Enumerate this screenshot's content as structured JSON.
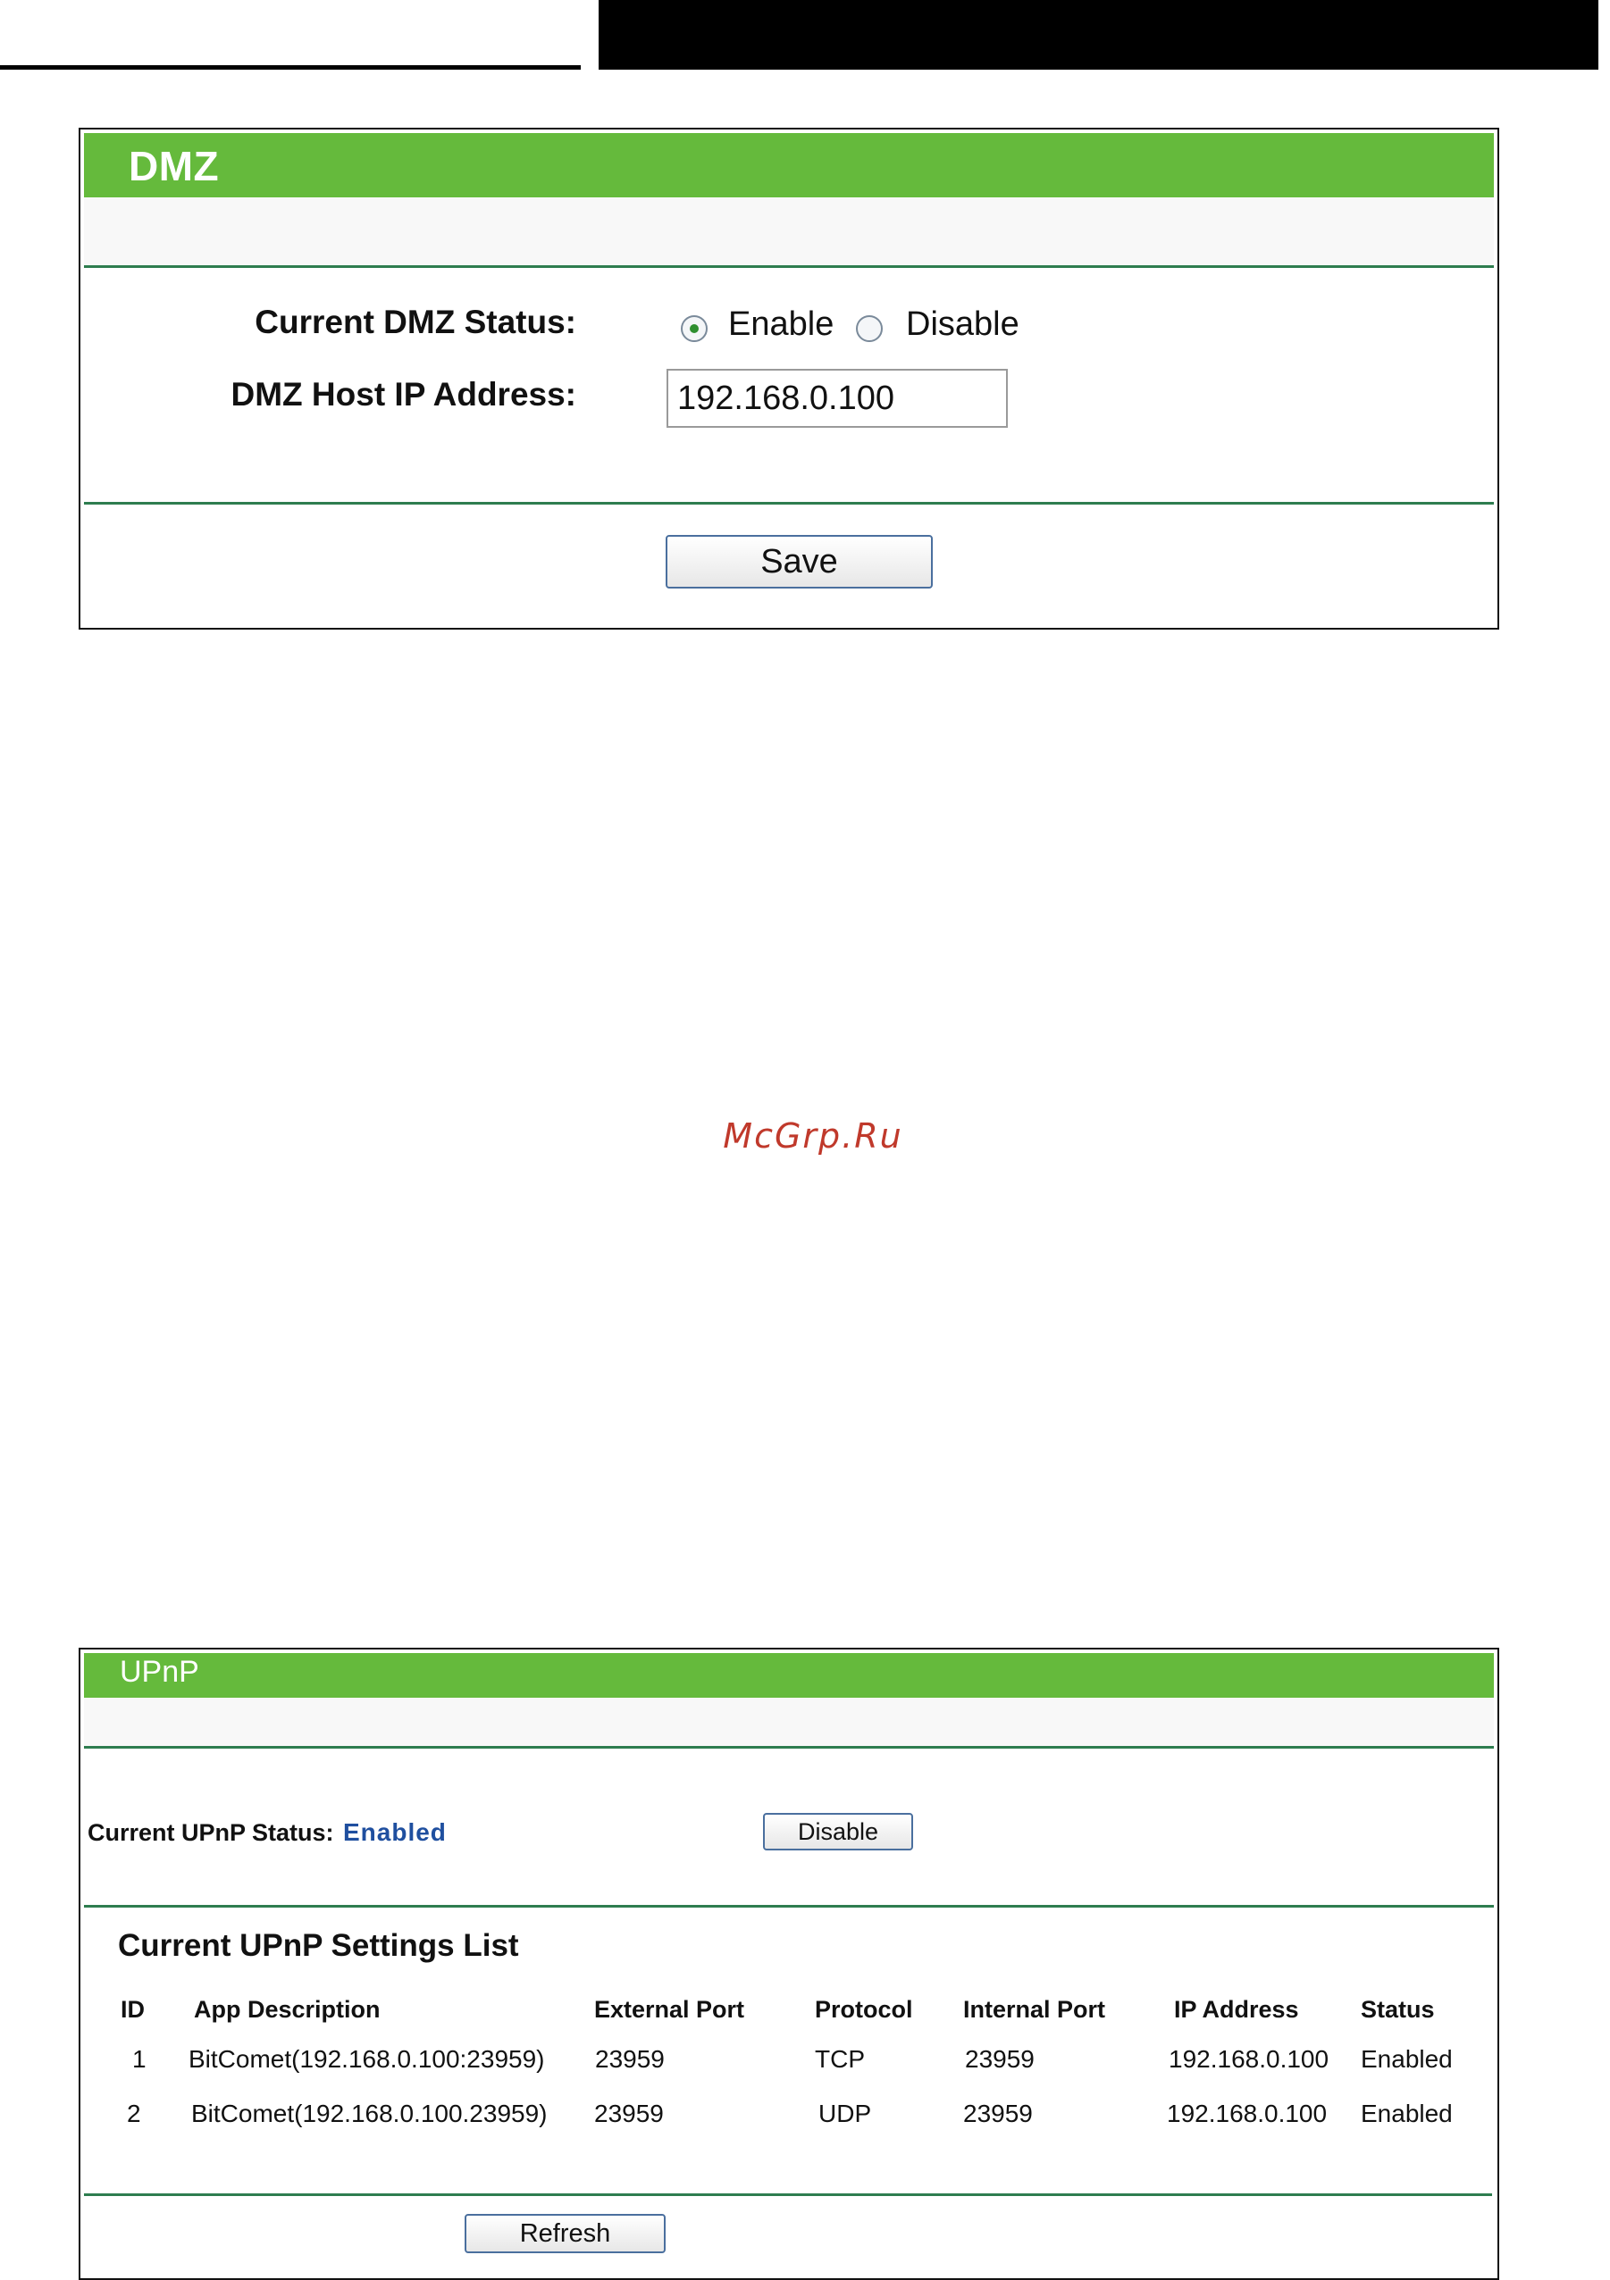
{
  "dmz": {
    "title": "DMZ",
    "status_label": "Current DMZ Status:",
    "enable_label": "Enable",
    "disable_label": "Disable",
    "selected": "Enable",
    "host_ip_label": "DMZ Host IP Address:",
    "host_ip_value": "192.168.0.100",
    "save_label": "Save"
  },
  "watermark": "McGrp.Ru",
  "upnp": {
    "title": "UPnP",
    "status_label": "Current UPnP Status:",
    "status_value": "Enabled",
    "disable_label": "Disable",
    "list_title": "Current UPnP Settings List",
    "columns": [
      "ID",
      "App Description",
      "External Port",
      "Protocol",
      "Internal Port",
      "IP Address",
      "Status"
    ],
    "rows": [
      [
        "1",
        "BitComet(192.168.0.100:23959)",
        "23959",
        "TCP",
        "23959",
        "192.168.0.100",
        "Enabled"
      ],
      [
        "2",
        "BitComet(192.168.0.100.23959)",
        "23959",
        "UDP",
        "23959",
        "192.168.0.100",
        "Enabled"
      ]
    ],
    "refresh_label": "Refresh"
  },
  "colors": {
    "header_green": "#65ba3c",
    "rule_green": "#2e7d4f",
    "status_blue": "#1f4f9f",
    "watermark_red": "#c0392b"
  }
}
